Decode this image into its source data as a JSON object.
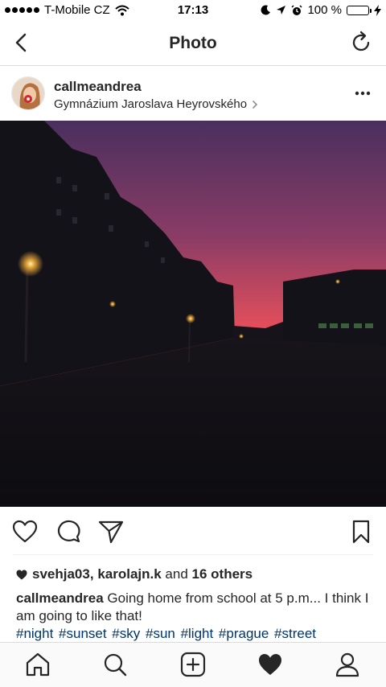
{
  "status_bar": {
    "carrier": "T-Mobile CZ",
    "time": "17:13",
    "battery": "100 %",
    "battery_level": 1.0,
    "battery_color": "#2ec531"
  },
  "nav": {
    "title": "Photo",
    "back_icon": "chevron-left-icon",
    "refresh_icon": "refresh-icon"
  },
  "post": {
    "username": "callmeandrea",
    "location": "Gymnázium Jaroslava Heyrovského",
    "more_icon": "more-horizontal-icon"
  },
  "actions": {
    "like_icon": "heart-outline-icon",
    "comment_icon": "comment-icon",
    "share_icon": "direct-share-icon",
    "save_icon": "bookmark-icon"
  },
  "likes": {
    "user1": "svehja03",
    "separator": ",",
    "user2": "karolajn.k",
    "and_text": "and",
    "others": "16 others"
  },
  "caption": {
    "username": "callmeandrea",
    "text": "Going home from school at 5 p.m... I think I am going to like that!",
    "hashtags": "#night  #sunset #sky #sun #light #prague #street"
  },
  "tab_bar": {
    "items": [
      "home-icon",
      "search-icon",
      "add-post-icon",
      "activity-heart-icon",
      "profile-icon"
    ],
    "active": "activity-heart-icon"
  },
  "colors": {
    "hashtag": "#003569",
    "text": "#262626",
    "sky_top": "#4a2f5e",
    "sky_glow": "#e8505a"
  }
}
